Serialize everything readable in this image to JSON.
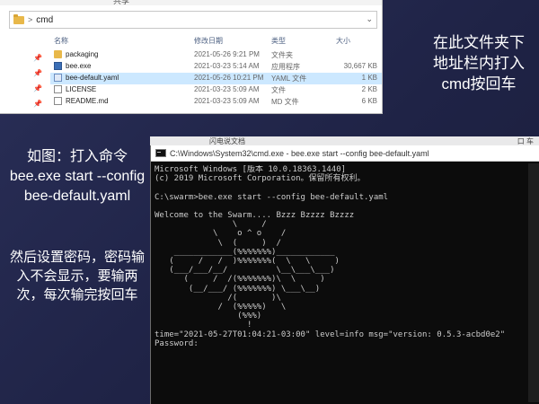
{
  "explorer": {
    "top_hint": "共享",
    "address_path": "cmd",
    "address_separator": ">",
    "dropdown_glyph": "⌄",
    "columns": {
      "name": "名称",
      "date": "修改日期",
      "type": "类型",
      "size": "大小"
    },
    "files": [
      {
        "name": "packaging",
        "date": "2021-05-26 9:21 PM",
        "type": "文件夹",
        "size": "",
        "icon": "folder-icon"
      },
      {
        "name": "bee.exe",
        "date": "2021-03-23 5:14 AM",
        "type": "应用程序",
        "size": "30,667 KB",
        "icon": "exe-icon"
      },
      {
        "name": "bee-default.yaml",
        "date": "2021-05-26 10:21 PM",
        "type": "YAML 文件",
        "size": "1 KB",
        "icon": "yaml-icon"
      },
      {
        "name": "LICENSE",
        "date": "2021-03-23 5:09 AM",
        "type": "文件",
        "size": "2 KB",
        "icon": "document-icon"
      },
      {
        "name": "README.md",
        "date": "2021-03-23 5:09 AM",
        "type": "MD 文件",
        "size": "6 KB",
        "icon": "markdown-icon"
      }
    ],
    "pin_glyph": "📌"
  },
  "captions": {
    "right": "在此文件夹下地址栏内打入cmd按回车",
    "left_1": "如图：打入命令bee.exe start --config bee-default.yaml",
    "left_2": "然后设置密码，密码输入不会显示，要输两次，每次输完按回车"
  },
  "background_window": {
    "left_text": "闪电说文档",
    "right_text": "口 车"
  },
  "cmd": {
    "title": "C:\\Windows\\System32\\cmd.exe - bee.exe  start --config bee-default.yaml",
    "lines": [
      "Microsoft Windows [版本 10.0.18363.1440]",
      "(c) 2019 Microsoft Corporation。保留所有权利。",
      "",
      "C:\\swarm>bee.exe start --config bee-default.yaml",
      "",
      "Welcome to the Swarm.... Bzzz Bzzzz Bzzzz",
      "                \\     /",
      "            \\    o ^ o    /",
      "             \\  (     )  /",
      "    ____________(%%%%%%%)____________",
      "   (     /   /  )%%%%%%%(  \\   \\     )",
      "   (___/___/__/          \\__\\___\\___)",
      "      (     /  /(%%%%%%%)\\  \\     )",
      "       (__/___/ (%%%%%%%) \\___\\__)",
      "               /(       )\\",
      "             /  (%%%%%)   \\",
      "                 (%%%)",
      "                   !",
      "time=\"2021-05-27T01:04:21-03:00\" level=info msg=\"version: 0.5.3-acbd0e2\"",
      "Password:"
    ]
  }
}
